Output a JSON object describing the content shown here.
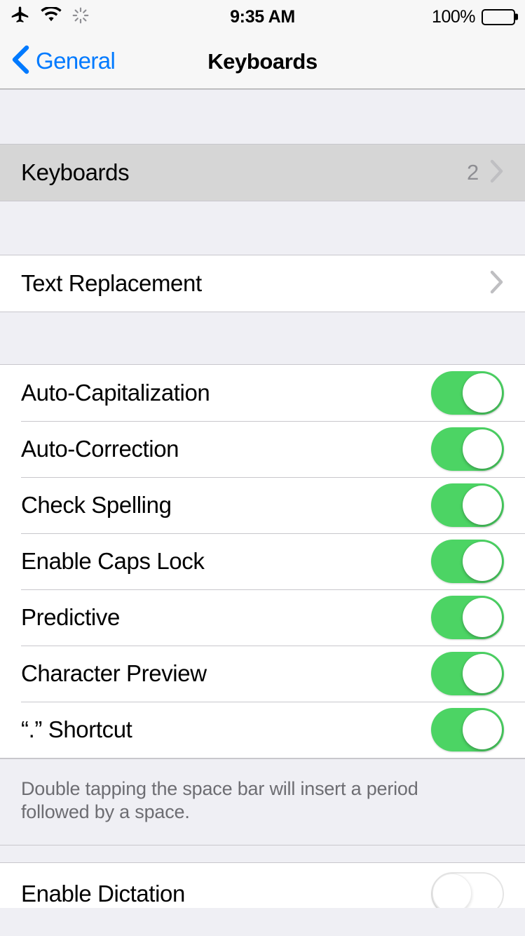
{
  "status_bar": {
    "airplane_icon": "airplane-icon",
    "wifi_icon": "wifi-icon",
    "activity_icon": "activity-spinner-icon",
    "time": "9:35 AM",
    "battery_percent": "100%",
    "battery_icon": "battery-full-icon"
  },
  "nav": {
    "back_icon": "chevron-left-icon",
    "back_label": "General",
    "title": "Keyboards"
  },
  "sections": [
    {
      "id": "keyboards-section",
      "rows": [
        {
          "label": "Keyboards",
          "value": "2",
          "type": "disclosure",
          "pressed": true
        }
      ]
    },
    {
      "id": "text-replacement-section",
      "rows": [
        {
          "label": "Text Replacement",
          "value": "",
          "type": "disclosure",
          "pressed": false
        }
      ]
    },
    {
      "id": "typing-options-section",
      "rows": [
        {
          "label": "Auto-Capitalization",
          "type": "switch",
          "on": true
        },
        {
          "label": "Auto-Correction",
          "type": "switch",
          "on": true
        },
        {
          "label": "Check Spelling",
          "type": "switch",
          "on": true
        },
        {
          "label": "Enable Caps Lock",
          "type": "switch",
          "on": true
        },
        {
          "label": "Predictive",
          "type": "switch",
          "on": true
        },
        {
          "label": "Character Preview",
          "type": "switch",
          "on": true
        },
        {
          "label": "“.” Shortcut",
          "type": "switch",
          "on": true
        }
      ]
    }
  ],
  "footer": {
    "text": "Double tapping the space bar will insert a period followed by a space."
  },
  "dictation_section": {
    "rows": [
      {
        "label": "Enable Dictation",
        "type": "switch",
        "on": false
      }
    ]
  },
  "colors": {
    "accent_blue": "#007AFF",
    "switch_on_green": "#4CD464",
    "group_background": "#EFEFF4",
    "separator": "#C8C7CC",
    "pressed_row": "#D6D6D6",
    "secondary_text": "#8E8E93",
    "footer_text": "#6D6D72"
  }
}
